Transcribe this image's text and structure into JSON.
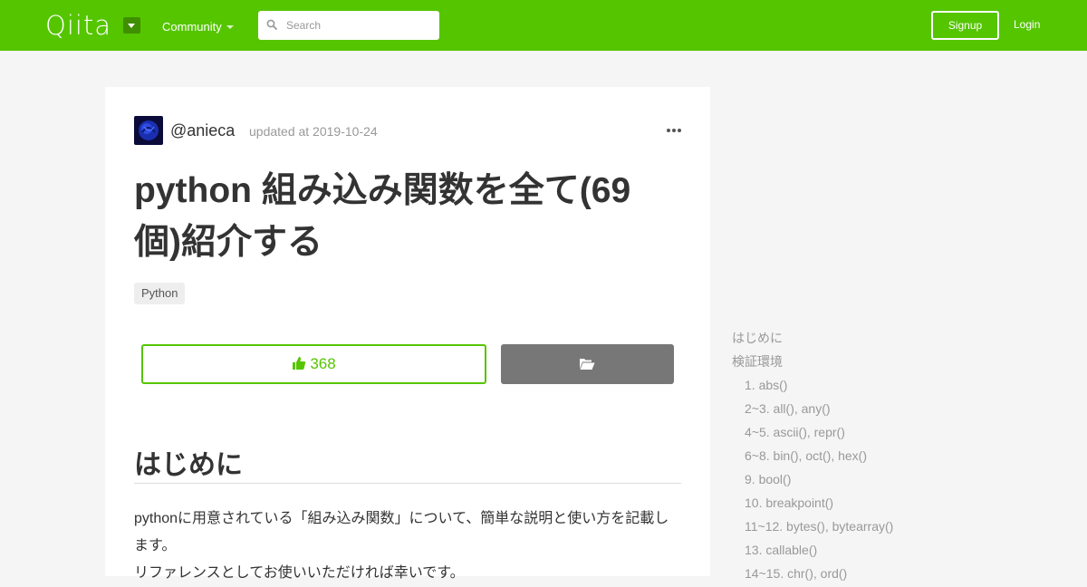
{
  "header": {
    "logo": "Qiita",
    "community_label": "Community",
    "search_placeholder": "Search",
    "signup_label": "Signup",
    "login_label": "Login"
  },
  "article": {
    "author": "@anieca",
    "updated": "updated at 2019-10-24",
    "title": "python 組み込み関数を全て(69個)紹介する",
    "tags": [
      "Python"
    ],
    "like_count": "368",
    "section_heading": "はじめに",
    "paragraph_1": "pythonに用意されている「組み込み関数」について、簡単な説明と使い方を記載します。",
    "paragraph_2": "リファレンスとしてお使いいただければ幸いです。"
  },
  "toc": {
    "items": [
      "はじめに",
      "検証環境",
      "1. abs()",
      "2~3. all(), any()",
      "4~5. ascii(), repr()",
      "6~8. bin(), oct(), hex()",
      "9. bool()",
      "10. breakpoint()",
      "11~12. bytes(), bytearray()",
      "13. callable()",
      "14~15. chr(), ord()"
    ]
  },
  "colors": {
    "brand": "#55c500",
    "stock_button": "#777777"
  }
}
